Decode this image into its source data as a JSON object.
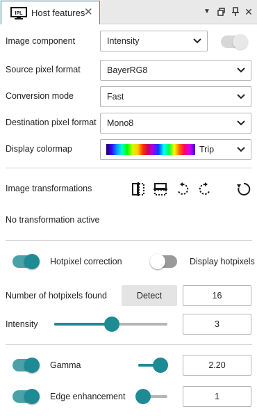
{
  "window": {
    "tab_title": "Host features",
    "tab_icon": "ipl-monitor-icon",
    "tab_icon_text": "IPL",
    "accent_color": "#1d8a94"
  },
  "image_component": {
    "label": "Image component",
    "value": "Intensity"
  },
  "source_pixel_format": {
    "label": "Source pixel format",
    "value": "BayerRG8"
  },
  "conversion_mode": {
    "label": "Conversion mode",
    "value": "Fast"
  },
  "destination_pixel_format": {
    "label": "Destination pixel format",
    "value": "Mono8"
  },
  "display_colormap": {
    "label": "Display colormap",
    "value": "Trip"
  },
  "transformations": {
    "label": "Image transformations",
    "status": "No transformation active",
    "icons": [
      "flip-horizontal-icon",
      "flip-vertical-icon",
      "rotate-left-icon",
      "rotate-right-icon",
      "reset-icon"
    ]
  },
  "hotpixel": {
    "correction_label": "Hotpixel correction",
    "correction_on": true,
    "display_label": "Display hotpixels",
    "display_on": false,
    "found_label": "Number of hotpixels found",
    "detect_label": "Detect",
    "found_value": "16",
    "intensity_label": "Intensity",
    "intensity_value": "3",
    "intensity_fraction": 0.51
  },
  "gamma": {
    "label": "Gamma",
    "on": true,
    "value": "2.20",
    "fraction": 1.0
  },
  "edge_enhancement": {
    "label": "Edge enhancement",
    "on": true,
    "value": "1",
    "fraction": 0.0
  }
}
